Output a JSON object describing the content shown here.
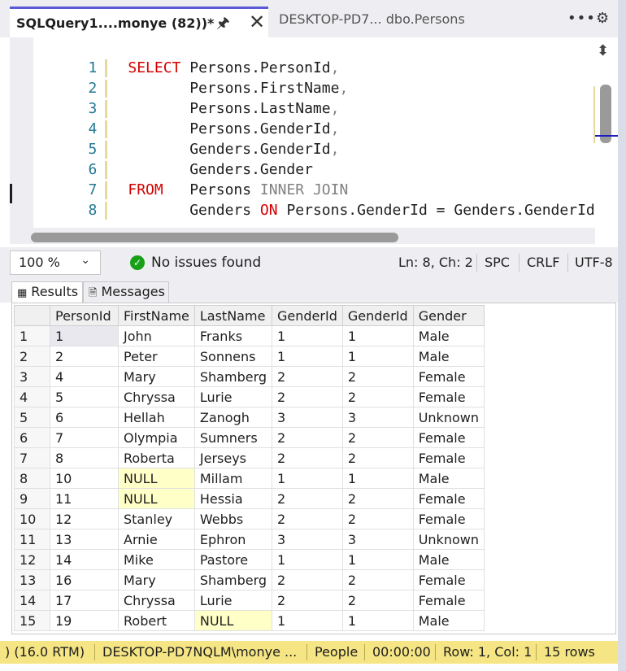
{
  "tabs": {
    "active_title": "SQLQuery1....monye (82))*",
    "inactive_title": "DESKTOP-PD7... dbo.Persons"
  },
  "editor": {
    "lines": [
      {
        "num": "1",
        "kw": "SELECT",
        "pad": " ",
        "code": "Persons.PersonId",
        "punct": ","
      },
      {
        "num": "2",
        "kw": "",
        "pad": "       ",
        "code": "Persons.FirstName",
        "punct": ","
      },
      {
        "num": "3",
        "kw": "",
        "pad": "       ",
        "code": "Persons.LastName",
        "punct": ","
      },
      {
        "num": "4",
        "kw": "",
        "pad": "       ",
        "code": "Persons.GenderId",
        "punct": ","
      },
      {
        "num": "5",
        "kw": "",
        "pad": "       ",
        "code": "Genders.GenderId",
        "punct": ","
      },
      {
        "num": "6",
        "kw": "",
        "pad": "       ",
        "code": "Genders.Gender",
        "punct": ""
      },
      {
        "num": "7",
        "kw": "FROM",
        "pad": "   ",
        "code": "Persons",
        "punct": " INNER JOIN"
      },
      {
        "num": "8",
        "kw": "",
        "pad": "       ",
        "code": "Genders",
        "punct": ""
      }
    ],
    "line8_on": "ON",
    "line8_rest": "Persons.GenderId = Genders.GenderId"
  },
  "status": {
    "zoom": "100 %",
    "issues": "No issues found",
    "position": "Ln: 8, Ch: 2",
    "indent": "SPC",
    "line_ending": "CRLF",
    "encoding": "UTF-8"
  },
  "results_tabs": {
    "results": "Results",
    "messages": "Messages"
  },
  "grid": {
    "columns": [
      "PersonId",
      "FirstName",
      "LastName",
      "GenderId",
      "GenderId",
      "Gender"
    ],
    "rows": [
      [
        "1",
        "1",
        "John",
        "Franks",
        "1",
        "1",
        "Male"
      ],
      [
        "2",
        "2",
        "Peter",
        "Sonnens",
        "1",
        "1",
        "Male"
      ],
      [
        "3",
        "4",
        "Mary",
        "Shamberg",
        "2",
        "2",
        "Female"
      ],
      [
        "4",
        "5",
        "Chryssa",
        "Lurie",
        "2",
        "2",
        "Female"
      ],
      [
        "5",
        "6",
        "Hellah",
        "Zanogh",
        "3",
        "3",
        "Unknown"
      ],
      [
        "6",
        "7",
        "Olympia",
        "Sumners",
        "2",
        "2",
        "Female"
      ],
      [
        "7",
        "8",
        "Roberta",
        "Jerseys",
        "2",
        "2",
        "Female"
      ],
      [
        "8",
        "10",
        "NULL",
        "Millam",
        "1",
        "1",
        "Male"
      ],
      [
        "9",
        "11",
        "NULL",
        "Hessia",
        "2",
        "2",
        "Female"
      ],
      [
        "10",
        "12",
        "Stanley",
        "Webbs",
        "2",
        "2",
        "Female"
      ],
      [
        "11",
        "13",
        "Arnie",
        "Ephron",
        "3",
        "3",
        "Unknown"
      ],
      [
        "12",
        "14",
        "Mike",
        "Pastore",
        "1",
        "1",
        "Male"
      ],
      [
        "13",
        "16",
        "Mary",
        "Shamberg",
        "2",
        "2",
        "Female"
      ],
      [
        "14",
        "17",
        "Chryssa",
        "Lurie",
        "2",
        "2",
        "Female"
      ],
      [
        "15",
        "19",
        "Robert",
        "NULL",
        "1",
        "1",
        "Male"
      ]
    ]
  },
  "bottom_bar": {
    "version": ") (16.0 RTM)",
    "server_user": "DESKTOP-PD7NQLM\\monye ...",
    "database": "People",
    "elapsed": "00:00:00",
    "row_col": "Row: 1, Col: 1",
    "row_count": "15 rows"
  },
  "colors": {
    "keyword": "#d40000",
    "null_cell": "#ffffc8",
    "status_bar": "#f5e584",
    "success": "#18a018"
  }
}
